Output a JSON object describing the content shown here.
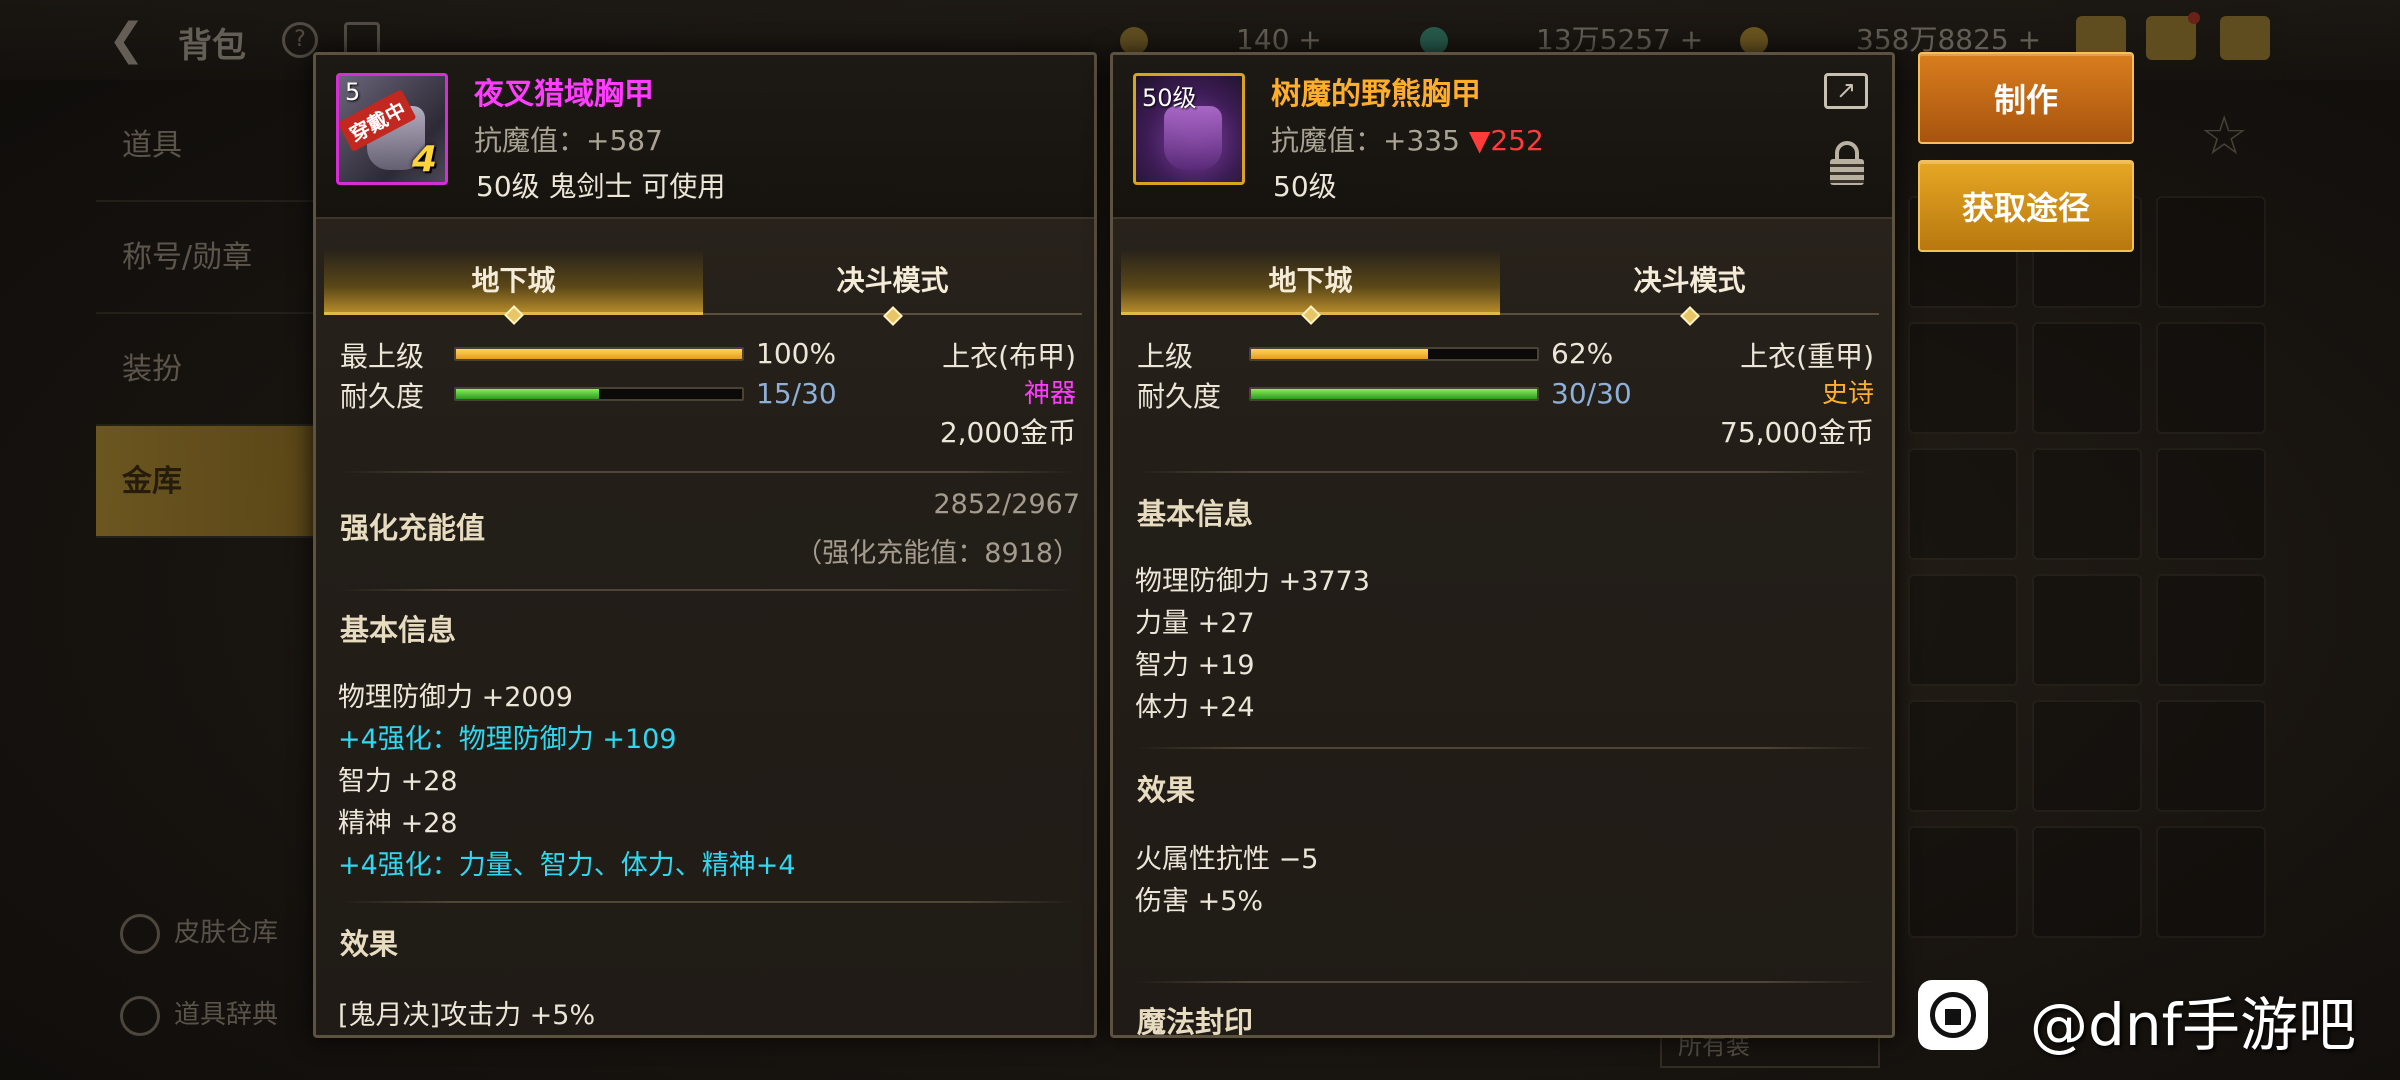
{
  "topbar": {
    "title": "背包",
    "currency_1": "140",
    "currency_2": "13万5257",
    "currency_3": "358万8825"
  },
  "side_menu": {
    "items": [
      {
        "label": "道具"
      },
      {
        "label": "称号/勋章"
      },
      {
        "label": "装扮"
      },
      {
        "label": "金库"
      }
    ],
    "bottom": [
      {
        "label": "皮肤仓库"
      },
      {
        "label": "道具辞典"
      }
    ]
  },
  "left_panel": {
    "icon_level": "5",
    "equipped_badge": "穿戴中",
    "enhance_level": "4",
    "name": "夜叉猎域胸甲",
    "resist": "抗魔值：+587",
    "requirement": "50级 鬼剑士 可使用",
    "tabs": [
      "地下城",
      "决斗模式"
    ],
    "grade_label": "最上级",
    "grade_fraction": 1.0,
    "grade_text": "100%",
    "durability_label": "耐久度",
    "durability_fraction": 0.5,
    "durability_text": "15/30",
    "slot_type": "上衣(布甲)",
    "rarity": "神器",
    "price": "2,000金币",
    "reinforce_title": "强化充能值",
    "reinforce_value": "2852/2967",
    "reinforce_sub": "（强化充能值：8918）",
    "basic_title": "基本信息",
    "basic_lines": [
      {
        "text": "物理防御力 +2009",
        "cyan": false
      },
      {
        "text": "+4强化：物理防御力 +109",
        "cyan": true
      },
      {
        "text": "智力 +28",
        "cyan": false
      },
      {
        "text": "精神 +28",
        "cyan": false
      },
      {
        "text": "+4强化：力量、智力、体力、精神+4",
        "cyan": true
      }
    ],
    "effect_title": "效果",
    "effect_lines": [
      "[鬼月决]攻击力 +5%"
    ]
  },
  "right_panel": {
    "icon_level": "50级",
    "name": "树魔的野熊胸甲",
    "resist_base": "抗魔值：+335",
    "resist_diff": "▼252",
    "requirement": "50级",
    "tabs": [
      "地下城",
      "决斗模式"
    ],
    "grade_label": "上级",
    "grade_fraction": 0.62,
    "grade_text": "62%",
    "durability_label": "耐久度",
    "durability_fraction": 1.0,
    "durability_text": "30/30",
    "slot_type": "上衣(重甲)",
    "rarity": "史诗",
    "price": "75,000金币",
    "basic_title": "基本信息",
    "basic_lines": [
      "物理防御力 +3773",
      "力量 +27",
      "智力 +19",
      "体力 +24"
    ],
    "effect_title": "效果",
    "effect_lines": [
      "火属性抗性 −5",
      "伤害 +5%"
    ],
    "seal_title": "魔法封印"
  },
  "buttons": {
    "make": "制作",
    "source": "获取途径"
  },
  "colors": {
    "artifact": "#ff3cff",
    "epic": "#ffae2c",
    "enhance": "#2fd8f0",
    "decrease": "#ff3b3b"
  },
  "watermark": {
    "text": "@dnf手游吧"
  },
  "background": {
    "filter_label": "所有装"
  }
}
